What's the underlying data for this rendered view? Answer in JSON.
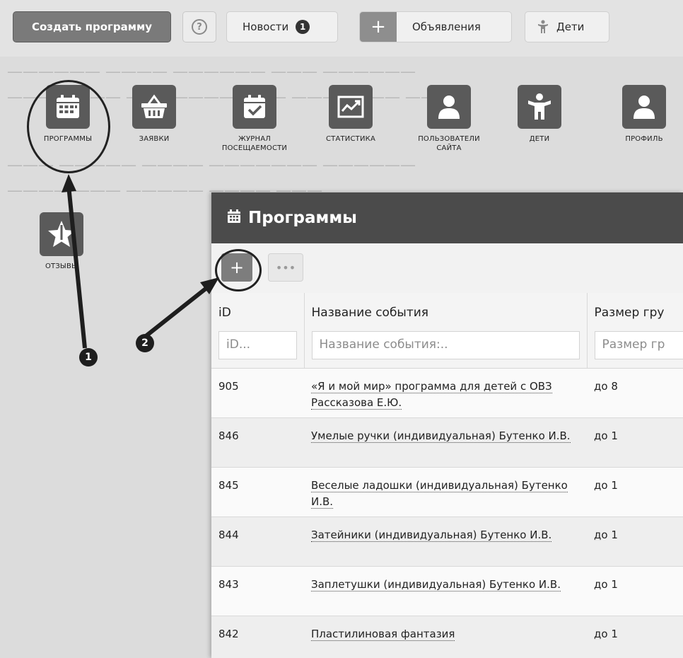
{
  "toolbar": {
    "create_label": "Создать программу",
    "help_symbol": "?",
    "news_label": "Новости",
    "news_count": "1",
    "ads_plus": "+",
    "ads_label": "Объявления",
    "kids_label": "Дети"
  },
  "tiles": [
    {
      "label": "ПРОГРАММЫ",
      "icon": "calendar-icon"
    },
    {
      "label": "ЗАЯВКИ",
      "icon": "basket-icon"
    },
    {
      "label": "ЖУРНАЛ ПОСЕЩАЕМОСТИ",
      "icon": "calendar-check-icon"
    },
    {
      "label": "СТАТИСТИКА",
      "icon": "chart-icon"
    },
    {
      "label": "ПОЛЬЗОВАТЕЛИ САЙТА",
      "icon": "user-icon"
    },
    {
      "label": "ДЕТИ",
      "icon": "child-icon"
    },
    {
      "label": "ПРОФИЛЬ",
      "icon": "user-icon"
    },
    {
      "label": "ОТЗЫВЫ",
      "icon": "star-icon"
    }
  ],
  "markers": [
    "1",
    "2"
  ],
  "panel": {
    "title": "Программы",
    "add_symbol": "+",
    "more_symbol": "•••",
    "columns": [
      "iD",
      "Название события",
      "Размер гру"
    ],
    "filters": [
      "iD...",
      "Название события:..",
      "Размер гр"
    ],
    "rows": [
      {
        "id": "905",
        "name": "«Я и мой мир» программа для детей с ОВЗ Рассказова Е.Ю.",
        "size": "до 8"
      },
      {
        "id": "846",
        "name": "Умелые ручки (индивидуальная) Бутенко И.В.",
        "size": "до 1"
      },
      {
        "id": "845",
        "name": "Веселые ладошки (индивидуальная) Бутенко И.В.",
        "size": "до 1"
      },
      {
        "id": "844",
        "name": "Затейники (индивидуальная) Бутенко И.В.",
        "size": "до 1"
      },
      {
        "id": "843",
        "name": "Заплетушки (индивидуальная) Бутенко И.В.",
        "size": "до 1"
      },
      {
        "id": "842",
        "name": "Пластилиновая фантазия",
        "size": "до 1"
      }
    ]
  }
}
